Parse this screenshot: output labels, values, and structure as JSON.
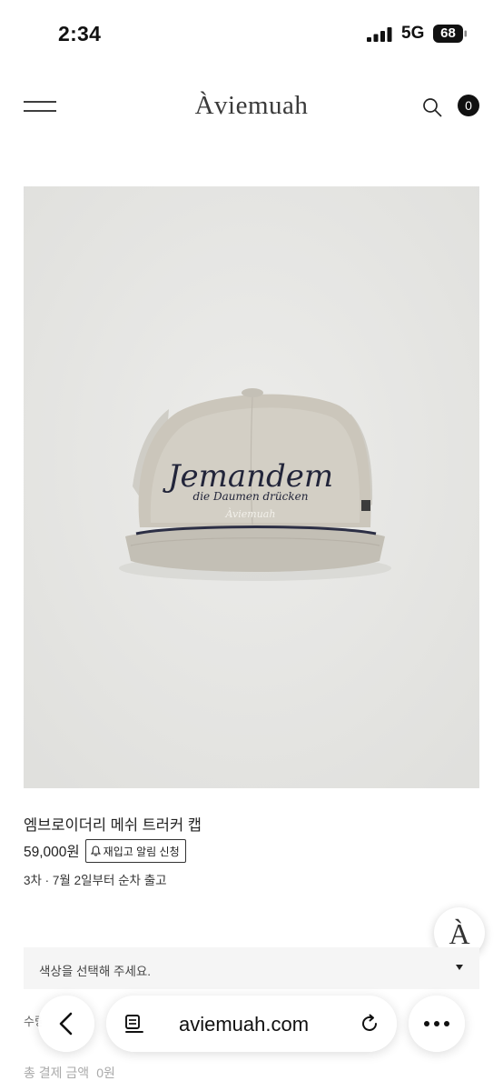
{
  "status_bar": {
    "time": "2:34",
    "network": "5G",
    "battery": "68"
  },
  "header": {
    "brand": "Àviemuah",
    "cart_count": "0"
  },
  "product": {
    "title": "엠브로이더리 메쉬 트러커 캡",
    "price": "59,000원",
    "restock_label": "재입고 알림 신청",
    "shipping_note": "3차 · 7월 2일부터 순차 출고",
    "cap_embroidery": [
      "Jemandem",
      "die Daumen drücken",
      "Àviemuah"
    ]
  },
  "float_logo": "À",
  "options": {
    "color_placeholder": "색상을 선택해 주세요.",
    "quantity_label": "수량"
  },
  "total": {
    "label": "총 결제 금액",
    "value": "0원"
  },
  "browser": {
    "url": "aviemuah.com"
  }
}
